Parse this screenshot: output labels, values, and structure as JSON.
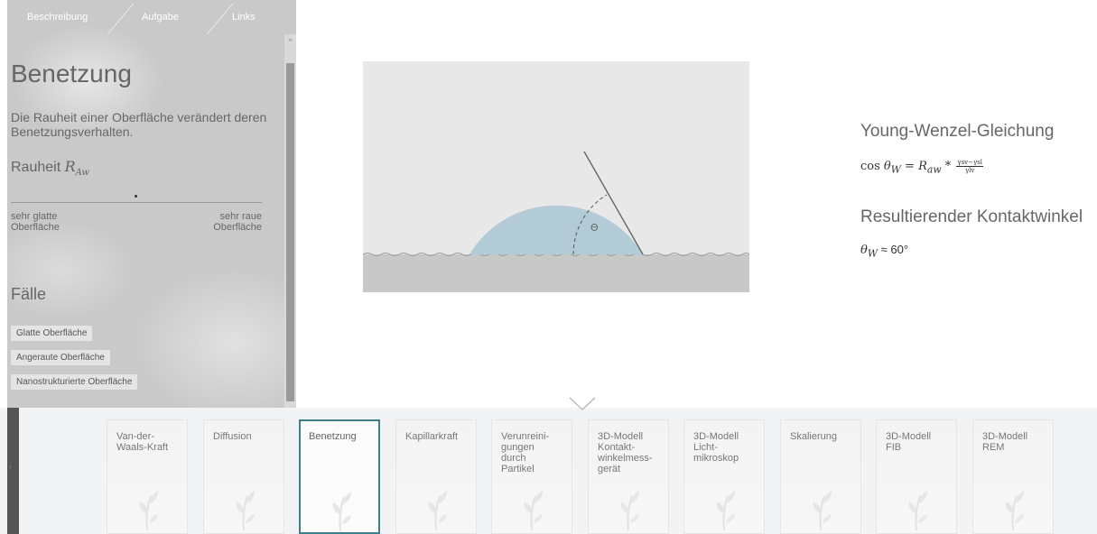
{
  "tabs": [
    {
      "label": "Beschreibung"
    },
    {
      "label": "Aufgabe"
    },
    {
      "label": "Links"
    }
  ],
  "panel": {
    "title": "Benetzung",
    "description": "Die Rauheit einer Oberfläche verändert deren Benetzungsverhalten.",
    "slider_label": "Rauheit",
    "slider_symbol": "R",
    "slider_symbol_sub": "Aw",
    "slider_value": 0.5,
    "min_label": "sehr glatte\nOberfläche",
    "max_label": "sehr raue\nOberfläche",
    "cases_heading": "Fälle",
    "cases": [
      {
        "label": "Glatte Oberfläche"
      },
      {
        "label": "Angeraute Oberfläche"
      },
      {
        "label": "Nanostrukturierte Oberfläche"
      }
    ]
  },
  "diagram": {
    "angle_label": "Θ"
  },
  "equation": {
    "title": "Young-Wenzel-Gleichung",
    "cos": "cos",
    "theta": "θ",
    "theta_sub": "W",
    "equals": "=",
    "r": "R",
    "r_sub": "aw",
    "times": "*",
    "numerator": "γsv−γsl",
    "denominator": "γlv"
  },
  "result": {
    "title": "Resultierender Kontaktwinkel",
    "theta": "θ",
    "theta_sub": "W",
    "approx": "≈",
    "value": "60°"
  },
  "cards": [
    {
      "label": "Van-der-\nWaals-Kraft",
      "active": false
    },
    {
      "label": "Diffusion",
      "active": false
    },
    {
      "label": "Benetzung",
      "active": true
    },
    {
      "label": "Kapillarkraft",
      "active": false
    },
    {
      "label": "Verunreini-\ngungen\ndurch\nPartikel",
      "active": false
    },
    {
      "label": "3D-Modell\nKontakt-\nwinkelmess-\ngerät",
      "active": false
    },
    {
      "label": "3D-Modell\nLicht-\nmikroskop",
      "active": false
    },
    {
      "label": "Skalierung",
      "active": false
    },
    {
      "label": "3D-Modell\nFIB",
      "active": false
    },
    {
      "label": "3D-Modell\nREM",
      "active": false
    }
  ],
  "colors": {
    "active_card_border": "#3b7f8c",
    "droplet": "#b3cbd6",
    "substrate": "#c8c8c8"
  }
}
